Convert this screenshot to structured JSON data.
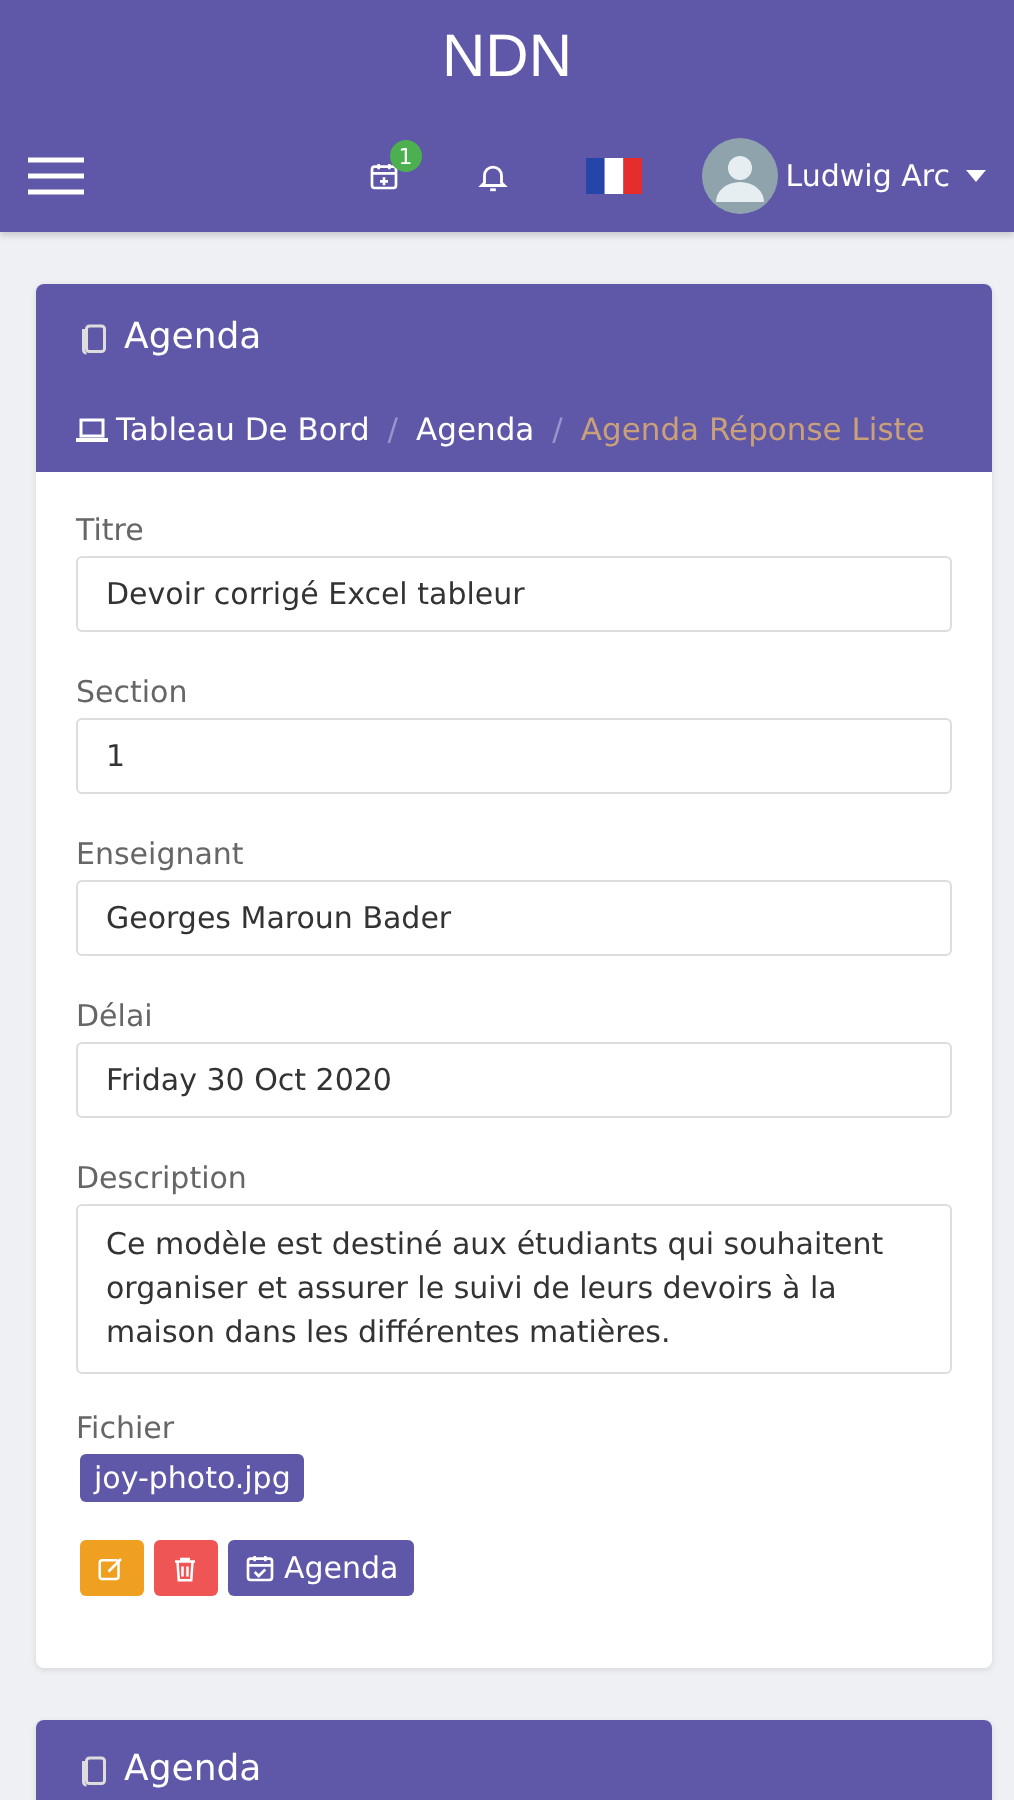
{
  "app_title": "NDN",
  "toolbar": {
    "calendar_badge": "1",
    "user_name": "Ludwig Arc"
  },
  "card": {
    "title": "Agenda",
    "breadcrumb_separator": "/",
    "breadcrumb": [
      {
        "label": "Tableau De Bord",
        "current": false
      },
      {
        "label": "Agenda",
        "current": false
      },
      {
        "label": "Agenda Réponse Liste",
        "current": true
      }
    ],
    "fields": [
      {
        "label": "Titre",
        "value": "Devoir corrigé Excel tableur",
        "kind": "input"
      },
      {
        "label": "Section",
        "value": "1",
        "kind": "input"
      },
      {
        "label": "Enseignant",
        "value": "Georges Maroun Bader",
        "kind": "input"
      },
      {
        "label": "Délai",
        "value": "Friday 30 Oct 2020",
        "kind": "input"
      },
      {
        "label": "Description",
        "value": "Ce modèle est destiné aux étudiants qui souhaitent organiser et assurer le suivi de leurs devoirs à la maison dans les différentes matières.",
        "kind": "textarea"
      }
    ],
    "file": {
      "label": "Fichier",
      "name": "joy-photo.jpg"
    },
    "actions": [
      {
        "kind": "edit"
      },
      {
        "kind": "delete"
      },
      {
        "kind": "agenda",
        "label": "Agenda"
      }
    ]
  },
  "next_card": {
    "title": "Agenda"
  }
}
